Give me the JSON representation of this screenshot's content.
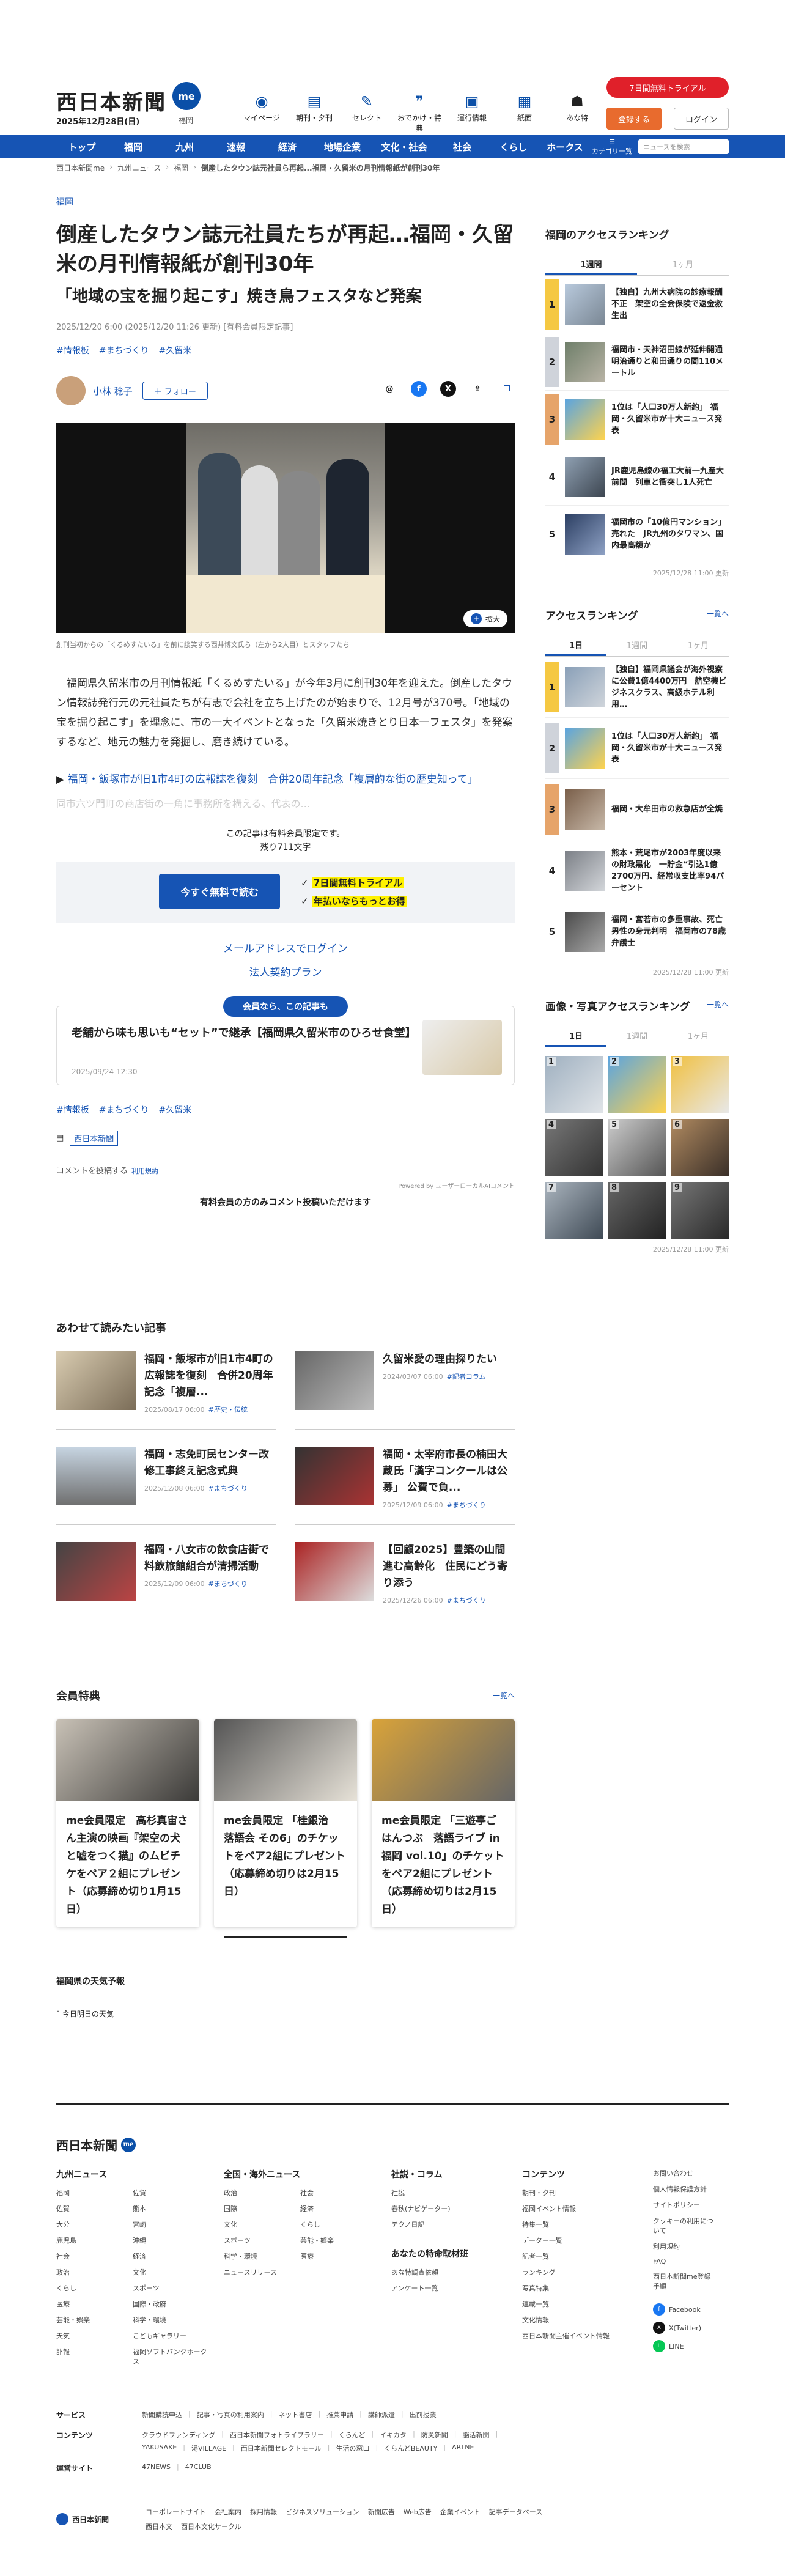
{
  "header": {
    "logo": "西日本新聞",
    "logo_badge": "me",
    "date": "2025年12月28日(日)",
    "location": "福岡",
    "icons": [
      {
        "label": "マイページ",
        "icon": "me-icon"
      },
      {
        "label": "朝刊・夕刊",
        "icon": "newspaper-icon"
      },
      {
        "label": "セレクト",
        "icon": "select-icon"
      },
      {
        "label": "おでかけ・特典",
        "icon": "footprint-icon"
      },
      {
        "label": "運行情報",
        "icon": "train-icon"
      },
      {
        "label": "紙面",
        "icon": "paper-icon"
      },
      {
        "label": "あな特",
        "icon": "owl-icon"
      }
    ],
    "trial": "7日間無料トライアル",
    "register": "登録する",
    "login": "ログイン"
  },
  "nav": {
    "items": [
      "トップ",
      "福岡",
      "九州",
      "速報",
      "経済",
      "地場企業",
      "文化・社会",
      "社会",
      "くらし",
      "ホークス"
    ],
    "category": "カテゴリ一覧",
    "search_placeholder": "ニュースを検索"
  },
  "breadcrumb": [
    "西日本新聞me",
    "九州ニュース",
    "福岡",
    "倒産したタウン誌元社員ら再起...福岡・久留米の月刊情報紙が創刊30年"
  ],
  "article": {
    "category": "福岡",
    "title": "倒産したタウン誌元社員たちが再起…福岡・久留米の月刊情報紙が創刊30年",
    "subtitle": "「地域の宝を掘り起こす」焼き鳥フェスタなど発案",
    "meta": "2025/12/20 6:00 (2025/12/20 11:26 更新) [有料会員限定記事]",
    "tags": [
      "#情報板",
      "#まちづくり",
      "#久留米"
    ],
    "author": "小林 稔子",
    "follow": "フォロー",
    "zoom": "拡大",
    "caption": "創刊当初からの「くるめすたいる」を前に談笑する西井博文氏ら（左から2人目）とスタッフたち",
    "body": "福岡県久留米市の月刊情報紙「くるめすたいる」が今年3月に創刊30年を迎えた。倒産したタウン情報誌発行元の元社員たちが有志で会社を立ち上げたのが始まりで、12月号が370号。「地域の宝を掘り起こす」を理念に、市の一大イベントとなった「久留米焼きとり日本一フェスタ」を発案するなど、地元の魅力を発掘し、磨き続けている。",
    "related_prefix": "▶",
    "related": "福岡・飯塚市が旧1市4町の広報誌を復刻　合併20周年記念「複層的な街の歴史知って」",
    "fade": "同市六ツ門町の商店街の一角に事務所を構える、代表の...",
    "paywall_note_1": "この記事は有料会員限定です。",
    "paywall_note_2": "残り711文字",
    "cta": "今すぐ無料で読む",
    "cta_points": [
      "7日間無料トライアル",
      "年払いならもっとお得"
    ],
    "mail_login": "メールアドレスでログイン",
    "corp": "法人契約プラン",
    "member_pill": "会員なら、この記事も",
    "member_title": "老舗から味も思いも“セット”で継承【福岡県久留米市のひろせ食堂】",
    "member_date": "2025/09/24 12:30",
    "tags2": [
      "#情報板",
      "#まちづくり",
      "#久留米"
    ],
    "publisher": "西日本新聞",
    "comment_label": "コメントを投稿する",
    "comment_terms": "利用規約",
    "powered": "Powered by ユーザーローカルAIコメント",
    "comment_note": "有料会員の方のみコメント投稿いただけます"
  },
  "recommended": {
    "title": "あわせて読みたい記事",
    "items": [
      {
        "title": "福岡・飯塚市が旧1市4町の広報誌を復刻　合併20周年記念「複層...",
        "date": "2025/08/17 06:00",
        "tag": "#歴史・伝統"
      },
      {
        "title": "久留米愛の理由探りたい",
        "date": "2024/03/07 06:00",
        "tag": "#記者コラム"
      },
      {
        "title": "福岡・志免町民センター改修工事終え記念式典",
        "date": "2025/12/08 06:00",
        "tag": "#まちづくり"
      },
      {
        "title": "福岡・太宰府市長の楠田大蔵氏「漢字コンクールは公募」 公費で負...",
        "date": "2025/12/09 06:00",
        "tag": "#まちづくり"
      },
      {
        "title": "福岡・八女市の飲食店街で料飲旅館組合が清掃活動",
        "date": "2025/12/09 06:00",
        "tag": "#まちづくり"
      },
      {
        "title": "【回顧2025】豊築の山間進む高齢化　住民にどう寄り添う",
        "date": "2025/12/26 06:00",
        "tag": "#まちづくり"
      }
    ]
  },
  "perks": {
    "title": "会員特典",
    "more": "一覧へ",
    "items": [
      {
        "title": "me会員限定　高杉真宙さん主演の映画『架空の犬と嘘をつく猫』のムビチケをペア２組にプレゼント（応募締め切り1月15日）"
      },
      {
        "title": "me会員限定 「桂銀治　落語会 その6」のチケットをペア2組にプレゼント（応募締め切りは2月15日）"
      },
      {
        "title": "me会員限定 「三遊亭ごはんつぶ　落語ライブ in 福岡 vol.10」のチケットをペア2組にプレゼント（応募締め切りは2月15日）"
      }
    ]
  },
  "weather": {
    "title": "福岡県の天気予報",
    "sub": "今日明日の天気"
  },
  "sidebar": {
    "access_title": "福岡のアクセスランキング",
    "access_tabs": [
      "1週間",
      "1ヶ月"
    ],
    "access_items": [
      "【独自】九州大病院の診療報酬不正　架空の全会保険で返金救生出",
      "福岡市・天神沼田線が延伸開通　明治通りと和田通りの間110メートル",
      "1位は「人口30万人新約」 福岡・久留米市が十大ニュース発表",
      "JR鹿児島線の福工大前一九産大前間　列車と衝突し1人死亡",
      "福岡市の「10億円マンション」売れた　JR九州のタワマン、国内最高額か"
    ],
    "access_updated": "2025/12/28 11:00 更新",
    "rank_title": "アクセスランキング",
    "rank_more": "一覧へ",
    "rank_tabs": [
      "1日",
      "1週間",
      "1ヶ月"
    ],
    "rank_items": [
      "【独自】福岡県議会が海外視察に公費1億4400万円　航空機ビジネスクラス、高級ホテル利用…",
      "1位は「人口30万人新約」 福岡・久留米市が十大ニュース発表",
      "福岡・大牟田市の救急店が全焼",
      "熊本・荒尾市が2003年度以来の財政黒化　一貯金“引込1億2700万円、経常収支比率94パーセント",
      "福岡・宮若市の多重事故、死亡男性の身元判明　福岡市の78歳弁護士"
    ],
    "rank_updated": "2025/12/28 11:00 更新",
    "photo_title": "画像・写真アクセスランキング",
    "photo_more": "一覧へ",
    "photo_tabs": [
      "1日",
      "1週間",
      "1ヶ月"
    ],
    "photo_updated": "2025/12/28 11:00 更新"
  },
  "footer": {
    "logo": "西日本新聞",
    "cols": [
      {
        "title": "九州ニュース",
        "items": [
          "福岡",
          "佐賀",
          "佐賀",
          "熊本",
          "大分",
          "宮崎",
          "鹿児島",
          "沖縄",
          "社会",
          "経済",
          "政治",
          "文化",
          "くらし",
          "スポーツ",
          "医療",
          "国際・政府",
          "芸能・娯楽",
          "科学・環境",
          "天気",
          "こどもギャラリー",
          "訃報",
          "福岡ソフトバンクホークス"
        ]
      },
      {
        "title": "全国・海外ニュース",
        "items": [
          "政治",
          "社会",
          "国際",
          "経済",
          "文化",
          "くらし",
          "スポーツ",
          "芸能・娯楽",
          "科学・環境",
          "医療",
          "ニュースリリース"
        ]
      },
      {
        "title": "社説・コラム",
        "items": [
          "社説",
          "春秋(ナビゲーター)",
          "テクノ日記"
        ]
      },
      {
        "title": "コンテンツ",
        "items": [
          "朝刊・夕刊",
          "福岡イベント情報",
          "特集一覧",
          "データー一覧",
          "記者一覧",
          "ランキング",
          "写真特集",
          "連載一覧",
          "文化情報",
          "西日本新聞主催イベント情報"
        ]
      }
    ],
    "anatoku_title": "あなたの特命取材班",
    "anatoku_items": [
      "あな特調査依頼",
      "アンケート一覧"
    ],
    "side_links": [
      "お問い合わせ",
      "個人情報保護方針",
      "サイトポリシー",
      "クッキーの利用について",
      "利用規約",
      "FAQ",
      "西日本新聞me登録手順"
    ],
    "sns": [
      "Facebook",
      "X(Twitter)",
      "LINE"
    ],
    "rows": [
      {
        "k": "サービス",
        "v": [
          "新聞購読申込",
          "記事・写真の利用案内",
          "ネット書店",
          "推薦申請",
          "講師派遣",
          "出前授業"
        ]
      },
      {
        "k": "コンテンツ",
        "v": [
          "クラウドファンディング",
          "西日本新聞フォトライブラリー",
          "くらんど",
          "イキカタ",
          "防災新聞",
          "脳活新聞",
          "YAKUSAKE",
          "湯VILLAGE",
          "西日本新聞セレクトモール",
          "生活の窓口",
          "くらんどBEAUTY",
          "ARTNE"
        ]
      },
      {
        "k": "運営サイト",
        "v": [
          "47NEWS",
          "47CLUB"
        ]
      }
    ],
    "bottom_logo": "西日本新聞",
    "bottom_links": [
      "コーポレートサイト",
      "会社案内",
      "採用情報",
      "ビジネスソリューション",
      "新聞広告",
      "Web広告",
      "企業イベント",
      "記事データベース",
      "西日本文",
      "西日本文化サークル"
    ]
  }
}
